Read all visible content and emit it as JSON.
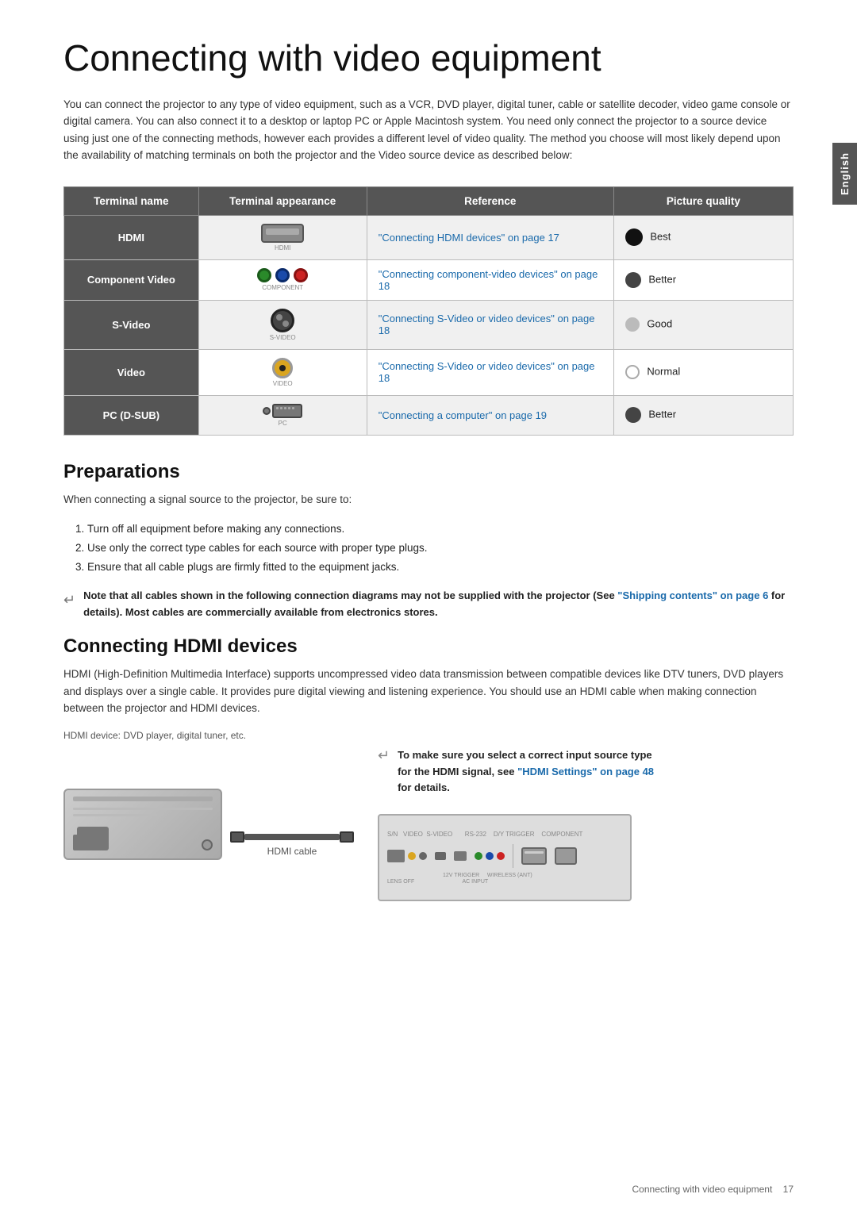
{
  "page": {
    "title": "Connecting with video equipment",
    "side_tab": "English",
    "intro": "You can connect the projector to any type of video equipment, such as a VCR, DVD player, digital tuner, cable or satellite decoder, video game console or digital camera. You can also connect it to a desktop or laptop PC or Apple Macintosh system. You need only connect the projector to a source device using just one of the connecting methods, however each provides a different level of video quality. The method you choose will most likely depend upon the availability of matching terminals on both the projector and the Video source device as described below:"
  },
  "table": {
    "headers": [
      "Terminal name",
      "Terminal appearance",
      "Reference",
      "Picture quality"
    ],
    "rows": [
      {
        "terminal": "HDMI",
        "appearance_type": "hdmi",
        "appearance_label": "HDMI",
        "reference": "\"Connecting HDMI devices\" on page 17",
        "quality_label": "Best",
        "quality_type": "best"
      },
      {
        "terminal": "Component Video",
        "appearance_type": "component",
        "appearance_label": "COMPONENT",
        "reference": "\"Connecting component-video devices\" on page 18",
        "quality_label": "Better",
        "quality_type": "better"
      },
      {
        "terminal": "S-Video",
        "appearance_type": "svideo",
        "appearance_label": "S-VIDEO",
        "reference": "\"Connecting S-Video or video devices\" on page 18",
        "quality_label": "Good",
        "quality_type": "good"
      },
      {
        "terminal": "Video",
        "appearance_type": "video",
        "appearance_label": "VIDEO",
        "reference": "\"Connecting S-Video or video devices\" on page 18",
        "quality_label": "Normal",
        "quality_type": "normal"
      },
      {
        "terminal": "PC (D-SUB)",
        "appearance_type": "pcsub",
        "appearance_label": "PC",
        "reference": "\"Connecting a computer\" on page 19",
        "quality_label": "Better",
        "quality_type": "better"
      }
    ]
  },
  "preparations": {
    "title": "Preparations",
    "intro": "When connecting a signal source to the projector, be sure to:",
    "steps": [
      "Turn off all equipment before making any connections.",
      "Use only the correct type cables for each source with proper type plugs.",
      "Ensure that all cable plugs are firmly fitted to the equipment jacks."
    ],
    "note": "Note that all cables shown in the following connection diagrams may not be supplied with the projector (See \"Shipping contents\" on page 6 for details). Most cables are commercially available from electronics stores."
  },
  "hdmi_section": {
    "title": "Connecting HDMI devices",
    "description": "HDMI (High-Definition Multimedia Interface) supports uncompressed video data transmission between compatible devices like DTV tuners, DVD players and displays over a single cable. It provides pure digital viewing and listening experience. You should use an HDMI cable when making connection between the projector and HDMI devices.",
    "device_label": "HDMI device: DVD player, digital tuner, etc.",
    "cable_label": "HDMI cable",
    "tip": "To make sure you select a correct input source type for the HDMI signal, see \"HDMI Settings\" on page 48 for details."
  },
  "footer": {
    "text": "Connecting with video equipment",
    "page_number": "17"
  }
}
